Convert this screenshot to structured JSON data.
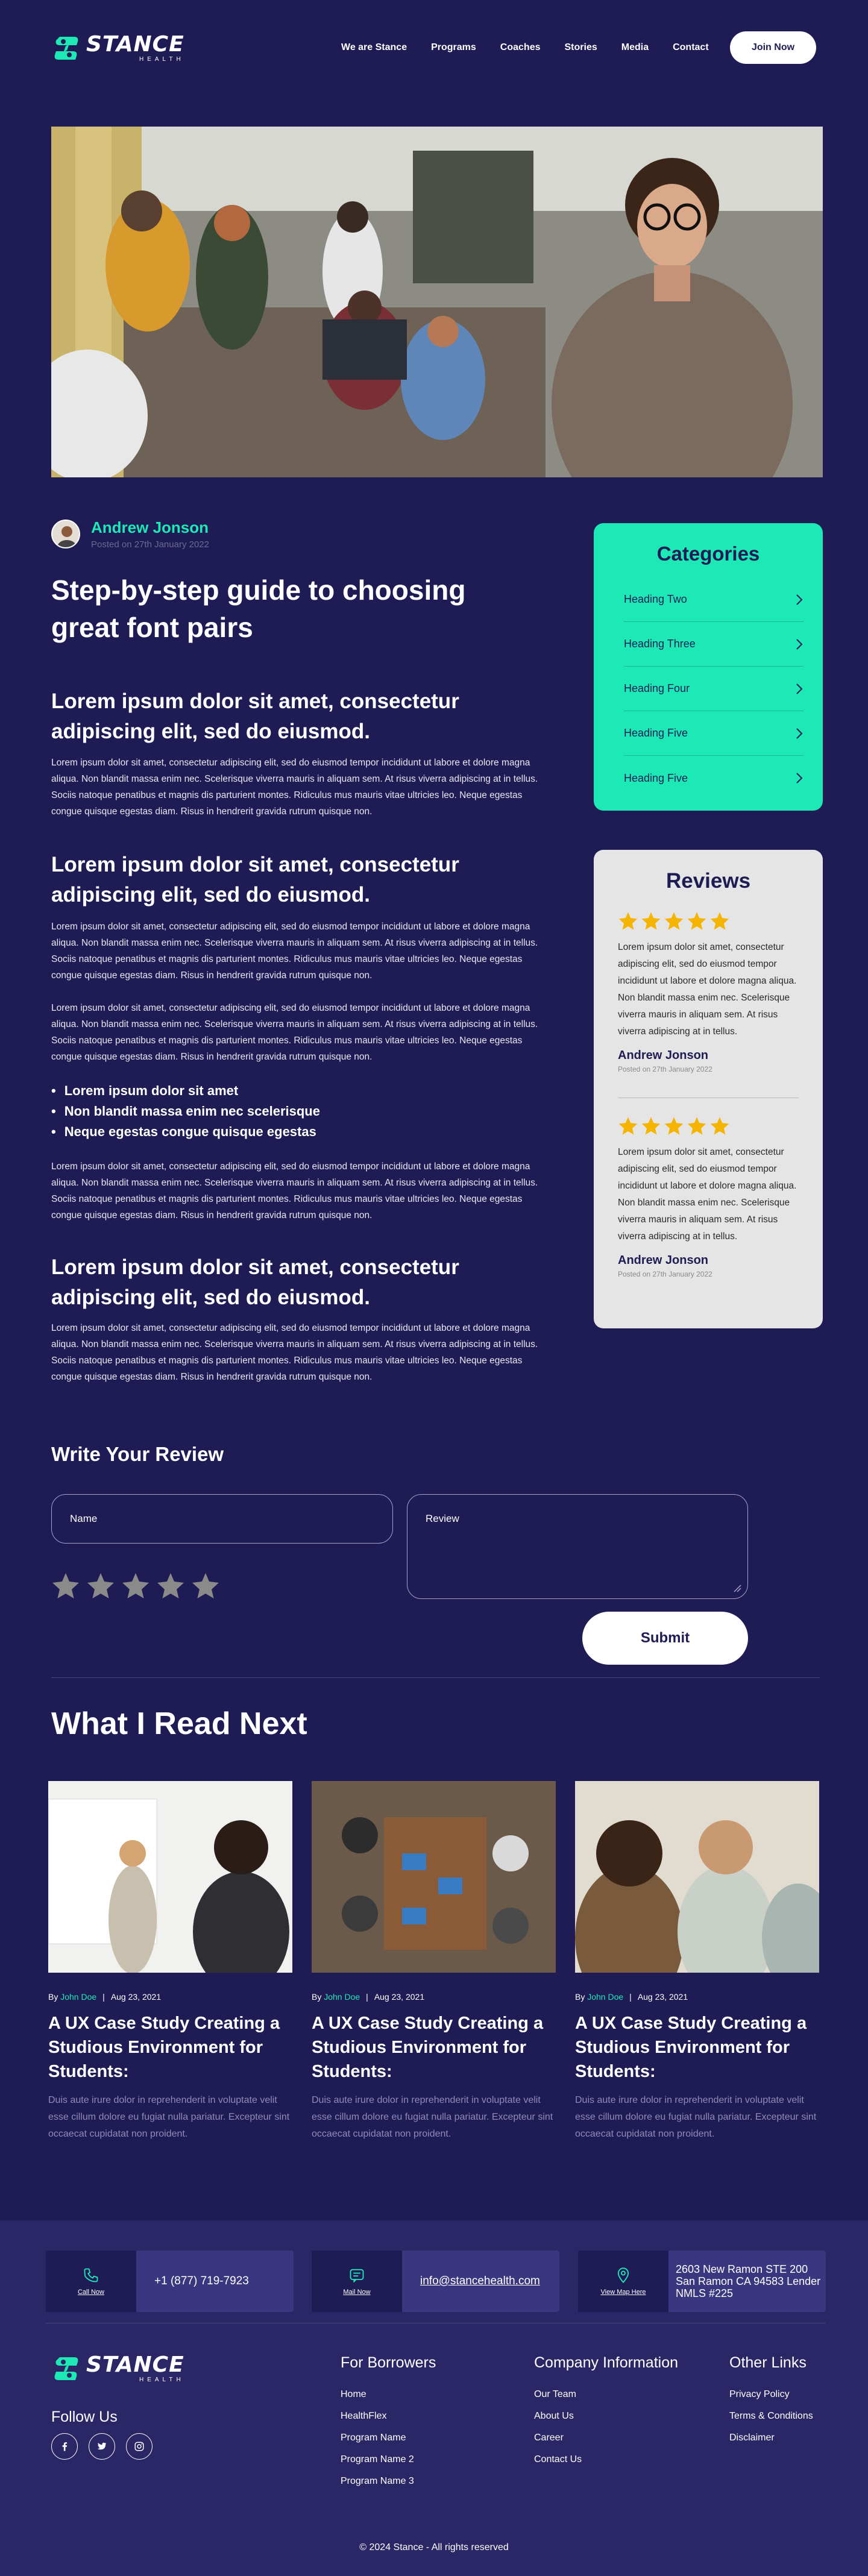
{
  "brand": {
    "name": "STANCE",
    "sub": "HEALTH",
    "accent": "#1de9b6",
    "bg": "#1f1b54"
  },
  "nav": {
    "items": [
      "We are Stance",
      "Programs",
      "Coaches",
      "Stories",
      "Media",
      "Contact"
    ],
    "cta": "Join Now"
  },
  "article": {
    "author": "Andrew Jonson",
    "posted": "Posted on 27th January 2022",
    "title": "Step-by-step guide to choosing great font pairs",
    "sections": [
      {
        "heading": "Lorem ipsum dolor sit amet, consectetur adipiscing elit, sed do eiusmod.",
        "paragraphs": [
          "Lorem ipsum dolor sit amet, consectetur adipiscing elit, sed do eiusmod tempor incididunt ut labore et dolore magna aliqua. Non blandit massa enim nec. Scelerisque viverra mauris in aliquam sem. At risus viverra adipiscing at in tellus. Sociis natoque penatibus et magnis dis parturient montes. Ridiculus mus mauris vitae ultricies leo. Neque egestas congue quisque egestas diam. Risus in hendrerit gravida rutrum quisque non."
        ]
      },
      {
        "heading": "Lorem ipsum dolor sit amet, consectetur adipiscing elit, sed do eiusmod.",
        "paragraphs": [
          "Lorem ipsum dolor sit amet, consectetur adipiscing elit, sed do eiusmod tempor incididunt ut labore et dolore magna aliqua. Non blandit massa enim nec. Scelerisque viverra mauris in aliquam sem. At risus viverra adipiscing at in tellus. Sociis natoque penatibus et magnis dis parturient montes. Ridiculus mus mauris vitae ultricies leo. Neque egestas congue quisque egestas diam. Risus in hendrerit gravida rutrum quisque non.",
          "Lorem ipsum dolor sit amet, consectetur adipiscing elit, sed do eiusmod tempor incididunt ut labore et dolore magna aliqua. Non blandit massa enim nec. Scelerisque viverra mauris in aliquam sem. At risus viverra adipiscing at in tellus. Sociis natoque penatibus et magnis dis parturient montes. Ridiculus mus mauris vitae ultricies leo. Neque egestas congue quisque egestas diam. Risus in hendrerit gravida rutrum quisque non."
        ],
        "bullets": [
          "Lorem ipsum dolor sit amet",
          "Non blandit massa enim nec scelerisque",
          "Neque egestas congue quisque egestas"
        ],
        "after": "Lorem ipsum dolor sit amet, consectetur adipiscing elit, sed do eiusmod tempor incididunt ut labore et dolore magna aliqua. Non blandit massa enim nec. Scelerisque viverra mauris in aliquam sem. At risus viverra adipiscing at in tellus. Sociis natoque penatibus et magnis dis parturient montes. Ridiculus mus mauris vitae ultricies leo. Neque egestas congue quisque egestas diam. Risus in hendrerit gravida rutrum quisque non."
      },
      {
        "heading": "Lorem ipsum dolor sit amet, consectetur adipiscing elit, sed do eiusmod.",
        "paragraphs": [
          "Lorem ipsum dolor sit amet, consectetur adipiscing elit, sed do eiusmod tempor incididunt ut labore et dolore magna aliqua. Non blandit massa enim nec. Scelerisque viverra mauris in aliquam sem. At risus viverra adipiscing at in tellus. Sociis natoque penatibus et magnis dis parturient montes. Ridiculus mus mauris vitae ultricies leo. Neque egestas congue quisque egestas diam. Risus in hendrerit gravida rutrum quisque non."
        ]
      }
    ]
  },
  "categories": {
    "title": "Categories",
    "items": [
      "Heading Two",
      "Heading Three",
      "Heading Four",
      "Heading Five",
      "Heading Five"
    ]
  },
  "reviews": {
    "title": "Reviews",
    "items": [
      {
        "rating": 5,
        "text": "Lorem ipsum dolor sit amet, consectetur adipiscing elit, sed do eiusmod tempor incididunt ut labore et dolore magna aliqua. Non blandit massa enim nec. Scelerisque viverra mauris in aliquam sem. At risus viverra adipiscing at in tellus.",
        "name": "Andrew Jonson",
        "date": "Posted on 27th January 2022"
      },
      {
        "rating": 5,
        "text": "Lorem ipsum dolor sit amet, consectetur adipiscing elit, sed do eiusmod tempor incididunt ut labore et dolore magna aliqua. Non blandit massa enim nec. Scelerisque viverra mauris in aliquam sem. At risus viverra adipiscing at in tellus.",
        "name": "Andrew Jonson",
        "date": "Posted on 27th January 2022"
      }
    ],
    "star_color": "#f5b400"
  },
  "write_review": {
    "title": "Write Your Review",
    "name_placeholder": "Name",
    "review_placeholder": "Review",
    "rating": 0,
    "submit": "Submit"
  },
  "read_next": {
    "title": "What I Read Next",
    "cards": [
      {
        "by": "By",
        "author": "John Doe",
        "date": "Aug 23, 2021",
        "title": "A UX Case Study Creating a Studious Environment for Students:",
        "desc": "Duis aute irure dolor in reprehenderit in voluptate velit esse cillum dolore eu fugiat nulla pariatur. Excepteur sint occaecat cupidatat non proident."
      },
      {
        "by": "By",
        "author": "John Doe",
        "date": "Aug 23, 2021",
        "title": "A UX Case Study Creating a Studious Environment for Students:",
        "desc": "Duis aute irure dolor in reprehenderit in voluptate velit esse cillum dolore eu fugiat nulla pariatur. Excepteur sint occaecat cupidatat non proident."
      },
      {
        "by": "By",
        "author": "John Doe",
        "date": "Aug 23, 2021",
        "title": "A UX Case Study Creating a Studious Environment for Students:",
        "desc": "Duis aute irure dolor in reprehenderit in voluptate velit esse cillum dolore eu fugiat nulla pariatur. Excepteur sint occaecat cupidatat non proident."
      }
    ]
  },
  "footer": {
    "contacts": [
      {
        "action": "Call Now",
        "value": "+1 (877) 719-7923",
        "icon": "phone-icon"
      },
      {
        "action": "Mail Now",
        "value": "info@stancehealth.com",
        "icon": "mail-icon"
      },
      {
        "action": "View Map Here",
        "value": "2603 New Ramon STE 200 San Ramon CA 94583 Lender NMLS #225",
        "icon": "map-pin-icon"
      }
    ],
    "follow": "Follow Us",
    "columns": [
      {
        "title": "For Borrowers",
        "links": [
          "Home",
          "HealthFlex",
          "Program Name",
          "Program Name 2",
          "Program Name 3"
        ]
      },
      {
        "title": "Company Information",
        "links": [
          "Our Team",
          "About Us",
          "Career",
          "Contact Us"
        ]
      },
      {
        "title": "Other Links",
        "links": [
          "Privacy Policy",
          "Terms & Conditions",
          "Disclaimer"
        ]
      }
    ],
    "copyright": "© 2024 Stance - All rights reserved"
  }
}
